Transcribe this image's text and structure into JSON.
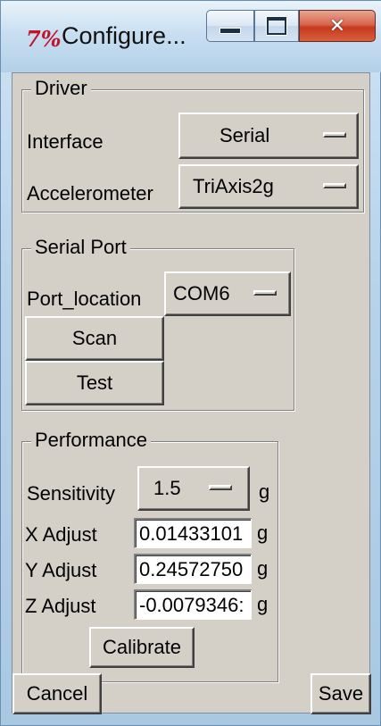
{
  "window": {
    "title": "Configure...",
    "app_icon": "tk-feather-icon"
  },
  "driver": {
    "title": "Driver",
    "interface_label": "Interface",
    "interface_value": "Serial",
    "accelerometer_label": "Accelerometer",
    "accelerometer_value": "TriAxis2g"
  },
  "serial_port": {
    "title": "Serial Port",
    "port_label": "Port_location",
    "port_value": "COM6",
    "scan_label": "Scan",
    "test_label": "Test"
  },
  "performance": {
    "title": "Performance",
    "sensitivity_label": "Sensitivity",
    "sensitivity_value": "1.5",
    "sensitivity_unit": "g",
    "x_label": "X Adjust",
    "x_value": "0.01433101",
    "x_unit": "g",
    "y_label": "Y Adjust",
    "y_value": "0.24572750",
    "y_unit": "g",
    "z_label": "Z Adjust",
    "z_value": "-0.0079346:",
    "z_unit": "g",
    "calibrate_label": "Calibrate"
  },
  "footer": {
    "cancel_label": "Cancel",
    "save_label": "Save"
  },
  "colors": {
    "close_button": "#c7391d",
    "background": "#d4d0c8",
    "app_icon": "#c0152a"
  }
}
